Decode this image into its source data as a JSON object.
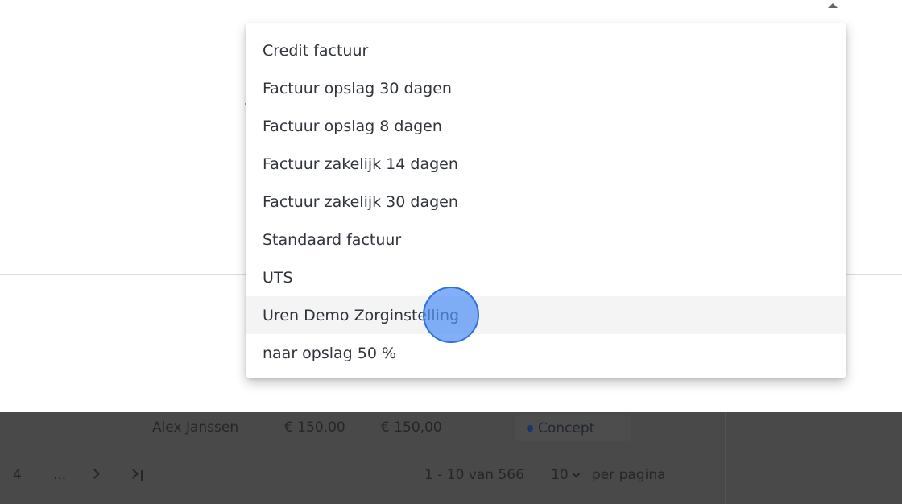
{
  "dropdown": {
    "options": [
      {
        "label": "Credit factuur"
      },
      {
        "label": "Factuur opslag 30 dagen"
      },
      {
        "label": "Factuur opslag 8 dagen"
      },
      {
        "label": "Factuur zakelijk 14 dagen"
      },
      {
        "label": "Factuur zakelijk 30 dagen"
      },
      {
        "label": "Standaard factuur"
      },
      {
        "label": "UTS"
      },
      {
        "label": "Uren Demo Zorginstelling"
      },
      {
        "label": "naar opslag 50 %"
      }
    ],
    "hovered_label": "Uren Demo Zorginstelling"
  },
  "table_row": {
    "name": "Alex Janssen",
    "amount_1": "€ 150,00",
    "amount_2": "€ 150,00",
    "status": "Concept"
  },
  "pagination": {
    "page": "4",
    "ellipsis": "...",
    "range": "1 - 10 van 566",
    "per_page_value": "10",
    "per_page_label": "per pagina"
  },
  "colors": {
    "accent": "#2f6fe0",
    "status_dot": "#17356f",
    "overlay": "#494949"
  },
  "icons": [
    "chevron-up-icon",
    "chevron-right-icon",
    "last-page-icon",
    "chevron-down-icon"
  ]
}
